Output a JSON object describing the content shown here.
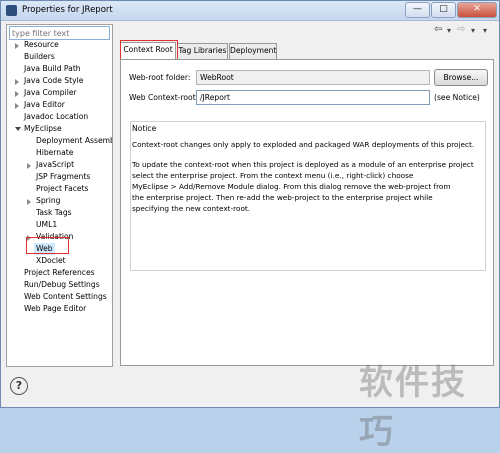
{
  "window": {
    "title": "Properties for JReport",
    "minimize_glyph": "—",
    "maximize_glyph": "□",
    "close_glyph": "✕"
  },
  "filter": {
    "placeholder": "type filter text"
  },
  "nav": {
    "back_glyph": "⇦",
    "dropdown_glyph": "▾",
    "forward_glyph": "⇨",
    "menu_glyph": "▾"
  },
  "tree": [
    {
      "label": "Resource",
      "expander": "right"
    },
    {
      "label": "Builders",
      "expander": "none"
    },
    {
      "label": "Java Build Path",
      "expander": "none"
    },
    {
      "label": "Java Code Style",
      "expander": "right"
    },
    {
      "label": "Java Compiler",
      "expander": "right"
    },
    {
      "label": "Java Editor",
      "expander": "right"
    },
    {
      "label": "Javadoc Location",
      "expander": "none"
    },
    {
      "label": "MyEclipse",
      "expander": "down"
    },
    {
      "label": "Deployment Assembl",
      "expander": "none"
    },
    {
      "label": "Hibernate",
      "expander": "none"
    },
    {
      "label": "JavaScript",
      "expander": "right"
    },
    {
      "label": "JSP Fragments",
      "expander": "none"
    },
    {
      "label": "Project Facets",
      "expander": "none"
    },
    {
      "label": "Spring",
      "expander": "right"
    },
    {
      "label": "Task Tags",
      "expander": "none"
    },
    {
      "label": "UML1",
      "expander": "none"
    },
    {
      "label": "Validation",
      "expander": "right"
    },
    {
      "label": "Web",
      "expander": "none",
      "selected": true
    },
    {
      "label": "XDoclet",
      "expander": "none"
    },
    {
      "label": "Project References",
      "expander": "none"
    },
    {
      "label": "Run/Debug Settings",
      "expander": "none"
    },
    {
      "label": "Web Content Settings",
      "expander": "none"
    },
    {
      "label": "Web Page Editor",
      "expander": "none"
    }
  ],
  "tabs": [
    {
      "label": "Context Root",
      "active": true
    },
    {
      "label": "Tag Libraries",
      "active": false
    },
    {
      "label": "Deployment",
      "active": false
    }
  ],
  "form": {
    "webroot_label": "Web-root folder:",
    "webroot_value": "WebRoot",
    "browse_label": "Browse...",
    "context_label": "Web Context-root:",
    "context_value": "/JReport",
    "see_notice": "(see Notice)"
  },
  "notice": {
    "title": "Notice",
    "para1": "Context-root changes only apply to exploded and packaged WAR deployments of this project.",
    "para2": "To update the context-root when this project is deployed as a module of an enterprise project\nselect the enterprise project. From the context menu (i.e., right-click) choose\nMyEclipse > Add/Remove Module dialog. From this dialog remove the web-project from\nthe enterprise project. Then re-add the web-project to the enterprise project while\nspecifying the new context-root."
  },
  "help": {
    "glyph": "?"
  },
  "watermark": {
    "text": "软件技巧"
  },
  "colors": {
    "highlight_box": "#e03030",
    "titlebar": "#c5d7ee"
  }
}
